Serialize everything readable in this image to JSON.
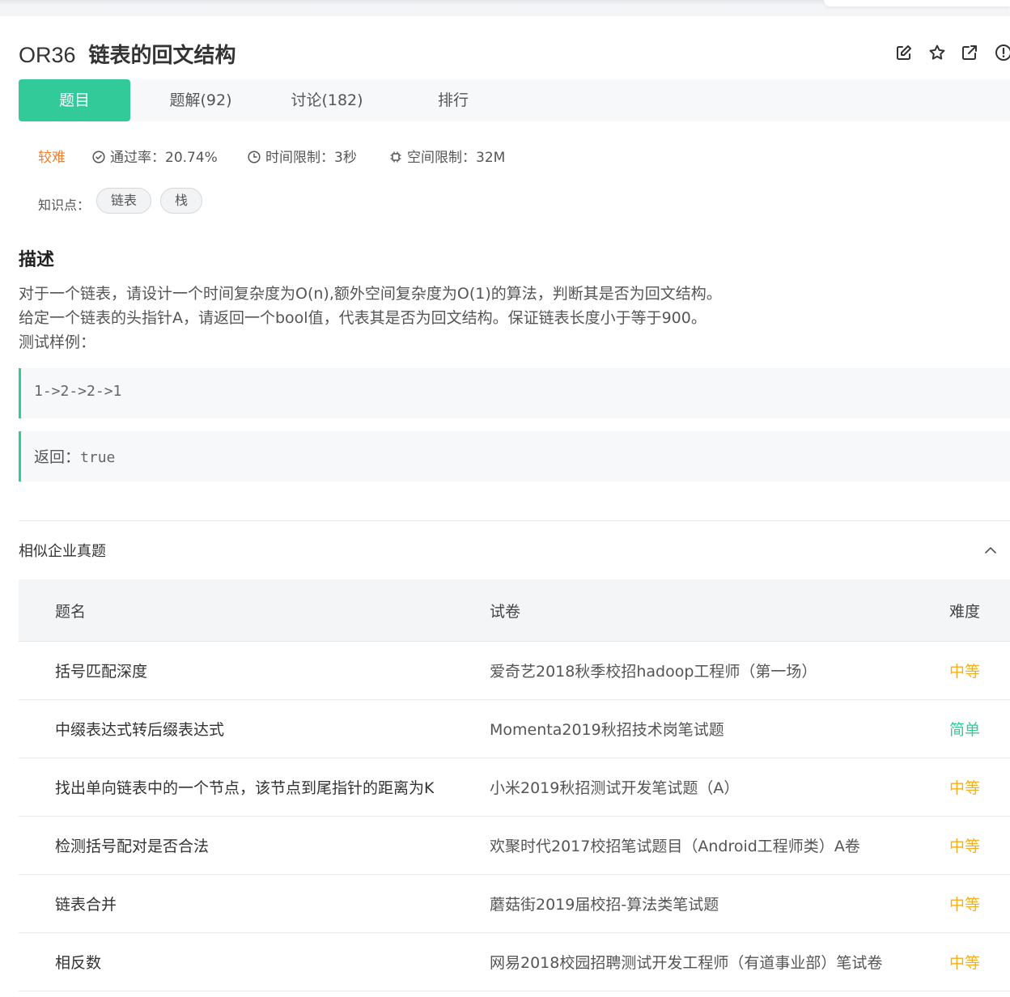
{
  "problem": {
    "code": "OR36",
    "title": "链表的回文结构"
  },
  "header_icons": [
    "edit-icon",
    "star-icon",
    "external-link-icon",
    "report-icon"
  ],
  "tabs": [
    {
      "label": "题目",
      "active": true
    },
    {
      "label": "题解(92)",
      "active": false
    },
    {
      "label": "讨论(182)",
      "active": false
    },
    {
      "label": "排行",
      "active": false
    }
  ],
  "meta": {
    "difficulty": "较难",
    "pass_rate": "通过率：20.74%",
    "time_limit": "时间限制：3秒",
    "space_limit": "空间限制：32M"
  },
  "knowledge": {
    "label": "知识点：",
    "tags": [
      "链表",
      "栈"
    ]
  },
  "description": {
    "heading": "描述",
    "lines": [
      "对于一个链表，请设计一个时间复杂度为O(n),额外空间复杂度为O(1)的算法，判断其是否为回文结构。",
      "给定一个链表的头指针A，请返回一个bool值，代表其是否为回文结构。保证链表长度小于等于900。",
      "测试样例："
    ],
    "sample_input": "1->2->2->1",
    "sample_output_label": "返回：",
    "sample_output_value": "true"
  },
  "similar": {
    "heading": "相似企业真题",
    "columns": [
      "题名",
      "试卷",
      "难度"
    ],
    "rows": [
      {
        "name": "括号匹配深度",
        "paper": "爱奇艺2018秋季校招hadoop工程师（第一场）",
        "level": "中等",
        "level_color": "#f2b01e"
      },
      {
        "name": "中缀表达式转后缀表达式",
        "paper": "Momenta2019秋招技术岗笔试题",
        "level": "简单",
        "level_color": "#32ca99"
      },
      {
        "name": "找出单向链表中的一个节点，该节点到尾指针的距离为K",
        "paper": "小米2019秋招测试开发笔试题（A）",
        "level": "中等",
        "level_color": "#f2b01e"
      },
      {
        "name": "检测括号配对是否合法",
        "paper": "欢聚时代2017校招笔试题目（Android工程师类）A卷",
        "level": "中等",
        "level_color": "#f2b01e"
      },
      {
        "name": "链表合并",
        "paper": "蘑菇街2019届校招-算法类笔试题",
        "level": "中等",
        "level_color": "#f2b01e"
      },
      {
        "name": "相反数",
        "paper": "网易2018校园招聘测试开发工程师（有道事业部）笔试卷",
        "level": "中等",
        "level_color": "#f2b01e"
      }
    ]
  },
  "colors": {
    "accent": "#32ca99",
    "difficulty_hard": "#f07d2a",
    "level_medium": "#f2b01e",
    "level_easy": "#32ca99"
  }
}
